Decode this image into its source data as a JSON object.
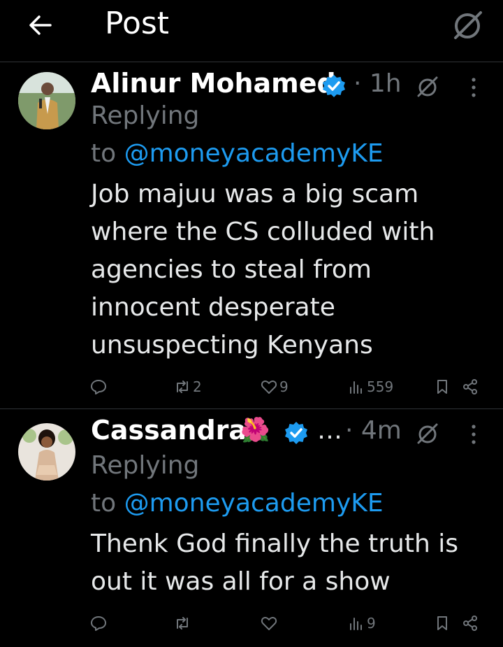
{
  "header": {
    "title": "Post"
  },
  "posts": [
    {
      "name": "Alinur Mohamed",
      "time": "· 1h",
      "reply_word": "Replying",
      "reply_to": "to ",
      "handle": "@moneyacademyKE",
      "text": "Job majuu was a big scam where the CS colluded with agencies to steal from innocent desperate unsuspecting Kenyans",
      "reposts": "2",
      "likes": "9",
      "views": "559"
    },
    {
      "name": "Cassandra",
      "emoji": "🌺",
      "ellipsis": "…",
      "time": "· 4m",
      "reply_word": "Replying",
      "reply_to": "to ",
      "handle": "@moneyacademyKE",
      "text": "Thenk God finally the truth is out it was all for a show",
      "reposts": "",
      "likes": "",
      "views": "9"
    }
  ],
  "colors": {
    "accent": "#1d9bf0",
    "muted": "#71767b",
    "text": "#e7e9ea",
    "divider": "#2f3336"
  },
  "icons": [
    "back-arrow-icon",
    "grok-icon",
    "verified-badge-icon",
    "more-icon",
    "reply-icon",
    "repost-icon",
    "like-icon",
    "views-icon",
    "bookmark-icon",
    "share-icon"
  ]
}
